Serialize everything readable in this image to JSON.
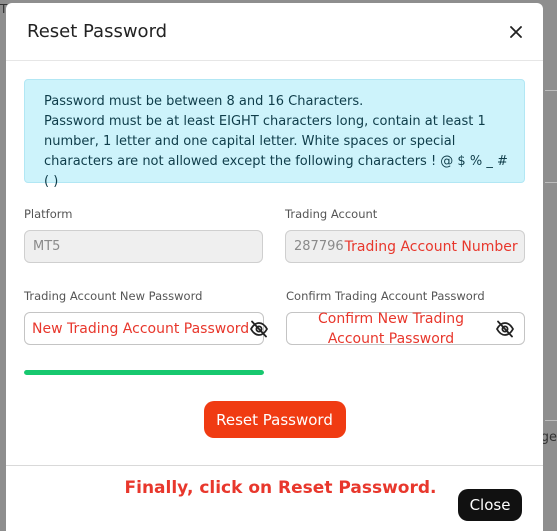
{
  "backdrop": {
    "left_text": "Tr",
    "right_text": "ge"
  },
  "modal": {
    "title": "Reset Password",
    "close_icon": "close-icon",
    "info": {
      "line1": "Password must be between 8 and 16 Characters.",
      "line2": "Password must be at least EIGHT characters long, contain at least 1 number, 1 letter and one capital letter. White spaces or special characters are not allowed except the following characters ! @ $ % _ # ( )"
    },
    "platform": {
      "label": "Platform",
      "value": "MT5"
    },
    "trading_account": {
      "label": "Trading Account",
      "value": "287796",
      "overlay": "Trading Account Number"
    },
    "new_password": {
      "label": "Trading Account New Password",
      "overlay": "New Trading Account Password",
      "icon": "eye-slash-icon"
    },
    "confirm_password": {
      "label": "Confirm Trading Account Password",
      "overlay": "Confirm New Trading Account Password",
      "icon": "eye-slash-icon"
    },
    "strength": {
      "level": 1.0,
      "color": "#17c86f"
    },
    "reset_button": "Reset Password",
    "annotation": "Finally, click on Reset Password.",
    "close_button": "Close"
  },
  "colors": {
    "accent": "#f03b12",
    "annotation": "#e8372c",
    "info_bg": "#cdf3fb"
  }
}
